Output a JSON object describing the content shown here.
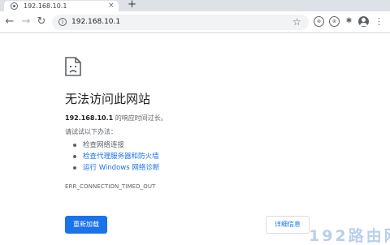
{
  "tab": {
    "title": "192.168.10.1",
    "close_glyph": "×",
    "new_tab_glyph": "+"
  },
  "window": {
    "minimize": "—",
    "maximize": "☐",
    "close": "✕"
  },
  "nav": {
    "back": "←",
    "forward": "→",
    "reload": "↻"
  },
  "omnibox": {
    "info": "i",
    "url": "192.168.10.1",
    "star": "☆"
  },
  "extensions": [
    "⊗",
    "⊗",
    "✱"
  ],
  "menu_glyph": "⋮",
  "error": {
    "title": "无法访问此网站",
    "host": "192.168.10.1",
    "host_suffix": " 的响应时间过长。",
    "try_label": "请试试以下办法：",
    "suggestions": [
      {
        "text": "检查网络连接",
        "link": false
      },
      {
        "text": "检查代理服务器和防火墙",
        "link": true
      },
      {
        "text": "运行 Windows 网络诊断",
        "link": true
      }
    ],
    "code": "ERR_CONNECTION_TIMED_OUT",
    "reload_label": "重新加载",
    "details_label": "详细信息"
  },
  "watermark": "192路由网",
  "colors": {
    "accent": "#1a73e8",
    "text": "#202124",
    "muted": "#5f6368"
  }
}
